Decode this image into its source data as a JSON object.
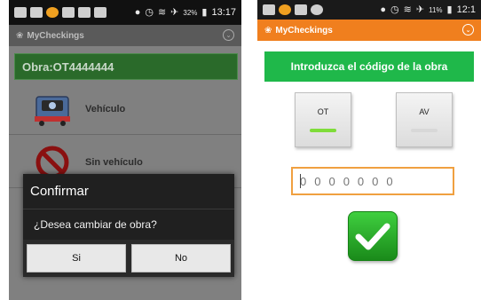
{
  "left_screen": {
    "status_time": "13:17",
    "status_battery": "32%",
    "app_title": "MyCheckings",
    "obra_label": "Obra:OT4444444",
    "list_items": [
      {
        "label": "Vehículo",
        "icon": "truck-icon"
      },
      {
        "label": "Sin vehículo",
        "icon": "no-entry-icon"
      }
    ],
    "dialog": {
      "title": "Confirmar",
      "message": "¿Desea cambiar de obra?",
      "yes_label": "Si",
      "no_label": "No"
    }
  },
  "right_screen": {
    "status_time": "12:1",
    "status_battery": "11%",
    "app_title": "MyCheckings",
    "instruction": "Introduzca el código de la obra",
    "toggle_ot": "OT",
    "toggle_av": "AV",
    "code_placeholder": "0000000",
    "confirm_icon": "checkmark-icon"
  },
  "colors": {
    "orange_actionbar": "#f07f1e",
    "green_instruction": "#1fb84a",
    "green_banner": "#2a6a2a",
    "input_border": "#f0a040",
    "ot_indicator": "#7fdc3a",
    "av_indicator": "#d8d8d8"
  }
}
